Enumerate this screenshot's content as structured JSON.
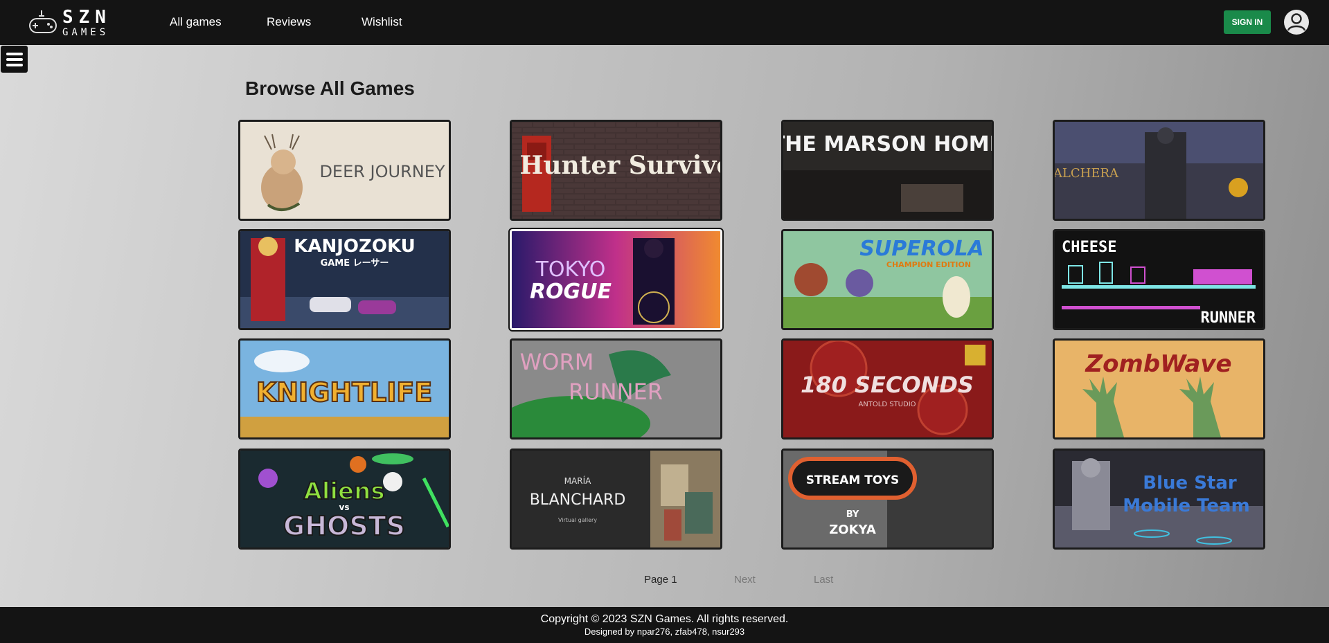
{
  "brand": {
    "name": "SZN",
    "sub": "GAMES"
  },
  "nav": {
    "links": [
      "All games",
      "Reviews",
      "Wishlist"
    ],
    "sign_in": "SIGN IN"
  },
  "page": {
    "title": "Browse All Games"
  },
  "games": [
    {
      "title": "DEER JOURNEY"
    },
    {
      "title": "Hunter Survivors"
    },
    {
      "title": "THE MARSON HOME"
    },
    {
      "title": "ALCHERA"
    },
    {
      "title": "KANJOZOKU",
      "sub": "GAME レーサー"
    },
    {
      "title": "TOKYO",
      "sub": "ROGUE"
    },
    {
      "title": "SUPEROLA",
      "sub": "CHAMPION EDITION"
    },
    {
      "title": "CHEESE",
      "sub": "RUNNER"
    },
    {
      "title": "KNIGHTLIFE"
    },
    {
      "title": "WORM",
      "sub": "RUNNER"
    },
    {
      "title": "180 SECONDS",
      "sub": "ANTOLD STUDIO"
    },
    {
      "title": "ZombWave"
    },
    {
      "title": "Aliens",
      "sub": "GHOSTS",
      "mid": "vs"
    },
    {
      "title": "MARÍA",
      "sub": "BLANCHARD",
      "caption": "Virtual gallery"
    },
    {
      "title": "STREAM TOYS",
      "sub": "BY",
      "caption": "ZOKYA"
    },
    {
      "title": "Blue Star",
      "sub": "Mobile Team"
    }
  ],
  "pagination": {
    "current": "Page 1",
    "next": "Next",
    "last": "Last"
  },
  "footer": {
    "copyright": "Copyright © 2023 SZN Games. All rights reserved.",
    "credit": "Designed by npar276, zfab478, nsur293"
  }
}
